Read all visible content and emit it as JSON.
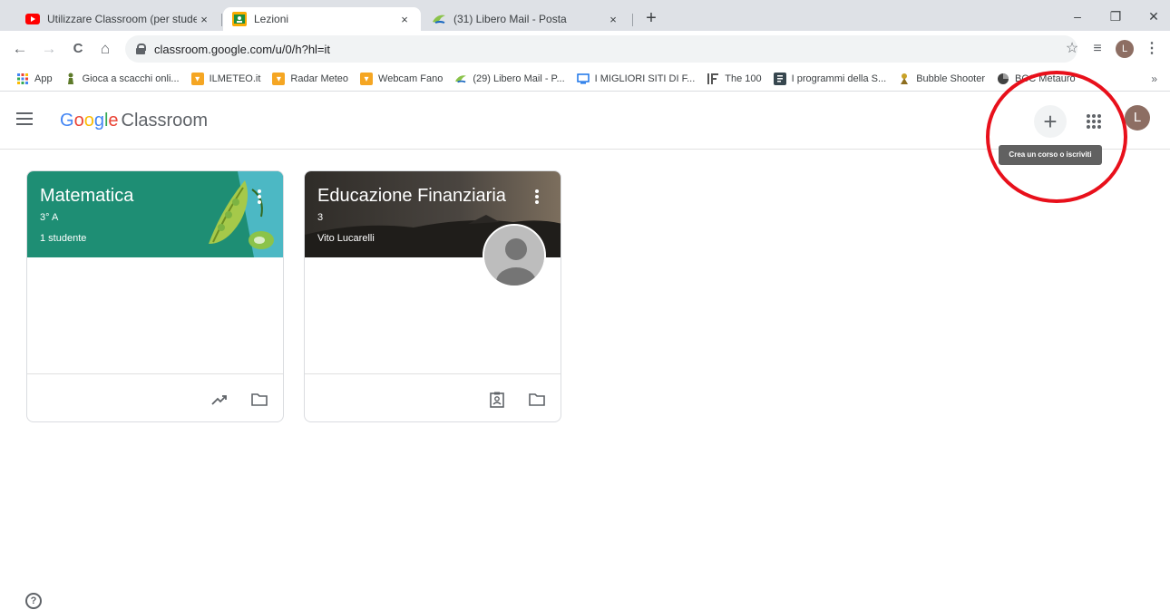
{
  "browser": {
    "tabs": [
      {
        "title": "Utilizzare Classroom (per student",
        "icon": "youtube-icon"
      },
      {
        "title": "Lezioni",
        "icon": "classroom-icon"
      },
      {
        "title": "(31) Libero Mail - Posta",
        "icon": "libero-icon"
      }
    ],
    "tab_close": "×",
    "new_tab": "+",
    "window_controls": {
      "minimize": "–",
      "restore": "❐",
      "close": "✕"
    },
    "nav": {
      "back": "←",
      "forward": "→",
      "reload": "C",
      "home": "⌂"
    },
    "url": "classroom.google.com/u/0/h?hl=it",
    "toolbar_right": {
      "star": "☆",
      "reading_list": "≡",
      "profile_initial": "L",
      "menu": "⋮"
    },
    "bookmarks": [
      {
        "label": "App",
        "icon": "apps-grid-icon"
      },
      {
        "label": "Gioca a scacchi onli...",
        "icon": "chess-pawn-icon"
      },
      {
        "label": "ILMETEO.it",
        "icon": "ilmeteo-icon"
      },
      {
        "label": "Radar Meteo",
        "icon": "ilmeteo-icon"
      },
      {
        "label": "Webcam Fano",
        "icon": "ilmeteo-icon"
      },
      {
        "label": "(29) Libero Mail - P...",
        "icon": "libero-icon"
      },
      {
        "label": "I MIGLIORI SITI DI F...",
        "icon": "site-icon"
      },
      {
        "label": "The 100",
        "icon": "the100-icon"
      },
      {
        "label": "I programmi della S...",
        "icon": "document-icon"
      },
      {
        "label": "Bubble Shooter",
        "icon": "bubble-shooter-icon"
      },
      {
        "label": "BCC Metauro",
        "icon": "bank-icon"
      }
    ],
    "bookmarks_more": "»"
  },
  "app": {
    "logo_letters": [
      "G",
      "o",
      "o",
      "g",
      "l",
      "e"
    ],
    "logo_product": "Classroom",
    "add_button": "+",
    "tooltip": "Crea un corso o iscriviti",
    "profile_initial": "L",
    "help": "?"
  },
  "courses": [
    {
      "title": "Matematica",
      "section": "3° A",
      "subtitle": "1 studente",
      "color": "#1e8e74"
    },
    {
      "title": "Educazione Finanziaria",
      "section": "3",
      "subtitle": "Vito Lucarelli",
      "color": "#3b3a36"
    }
  ]
}
